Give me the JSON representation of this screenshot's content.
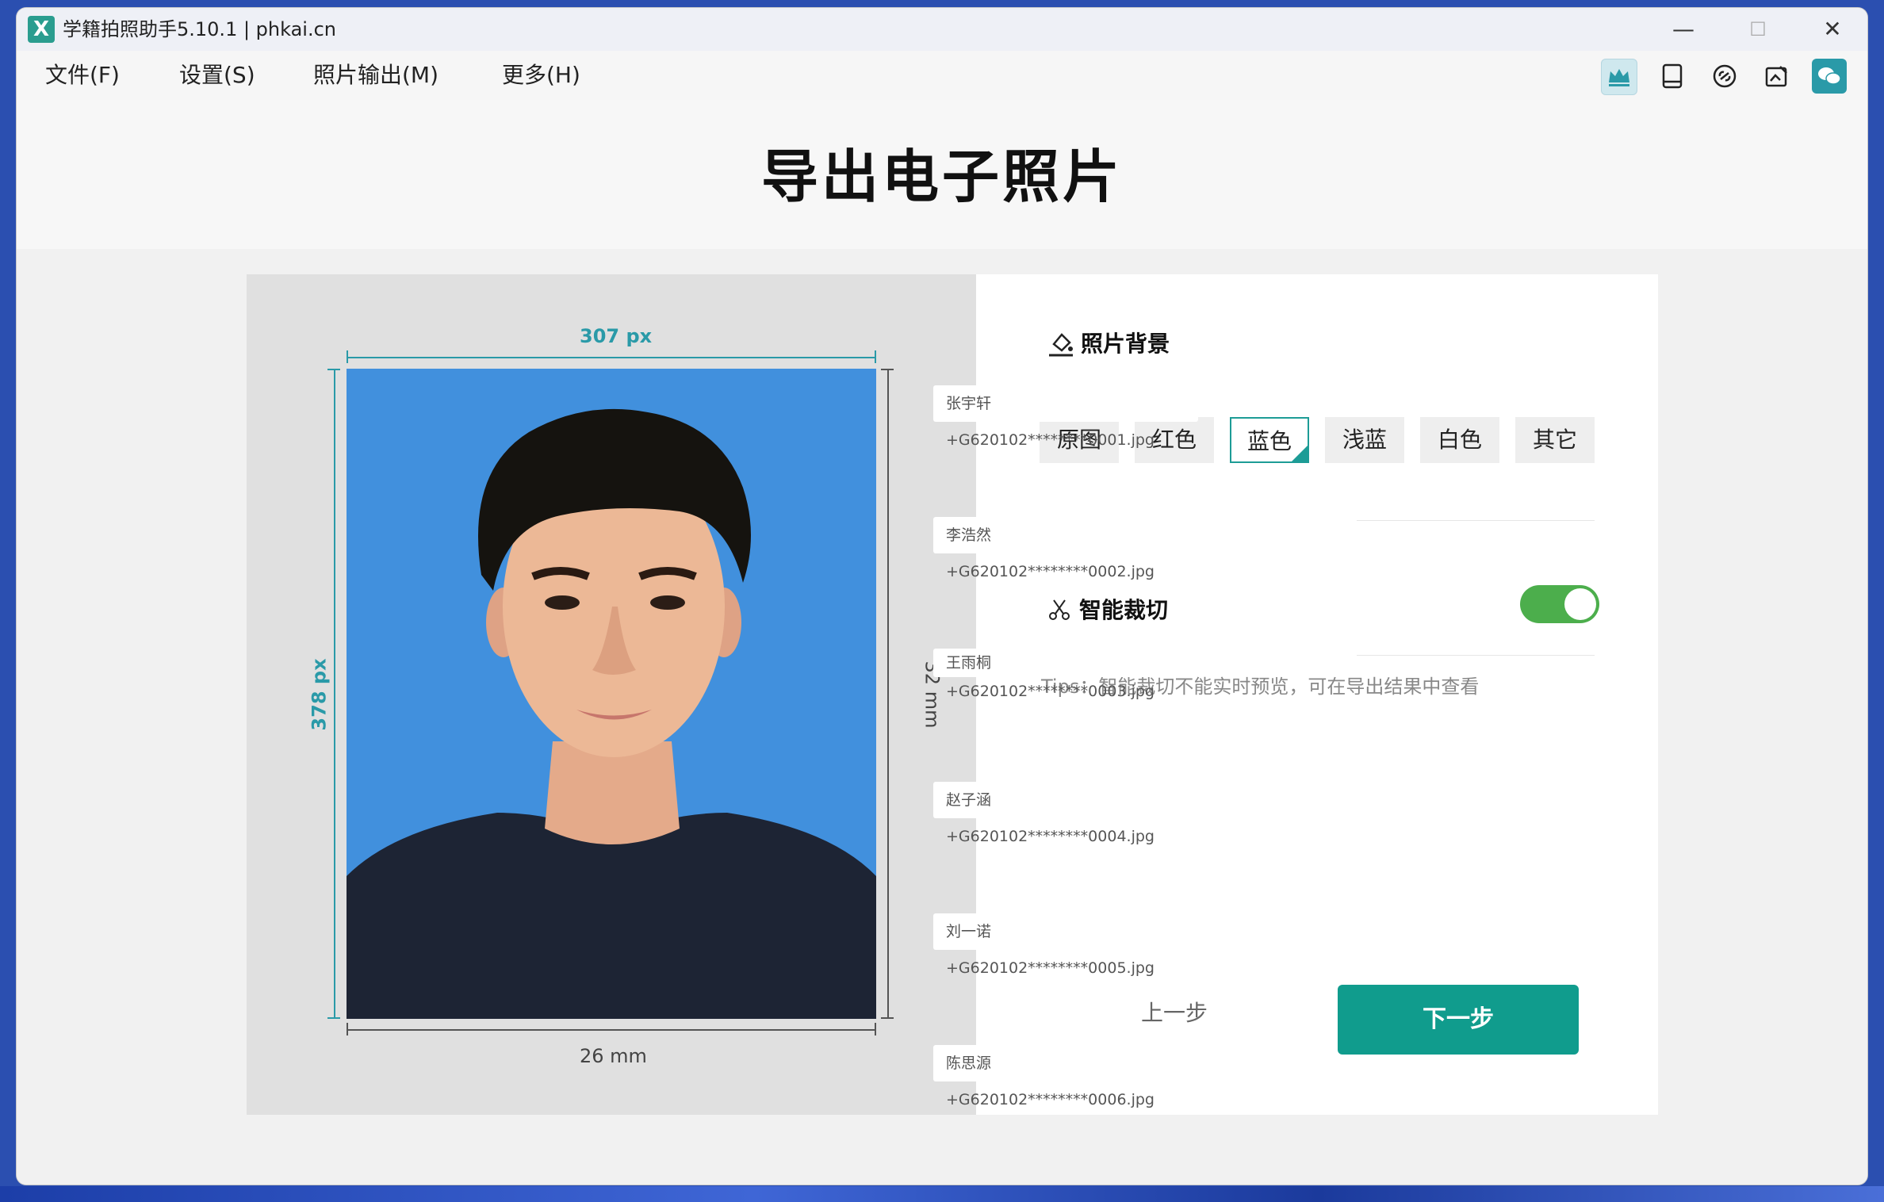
{
  "window": {
    "title": "学籍拍照助手5.10.1 | phkai.cn",
    "logo_letter": "X",
    "minimize": "—",
    "maximize": "☐",
    "close": "✕"
  },
  "menu": {
    "items": [
      "文件(F)",
      "设置(S)",
      "照片输出(M)",
      "更多(H)"
    ]
  },
  "toolbar": {
    "icons": [
      "crown-icon",
      "tablet-icon",
      "link-icon",
      "image-edit-icon",
      "wechat-icon"
    ],
    "accent": "#2a9d8f"
  },
  "page": {
    "title": "导出电子照片"
  },
  "preview": {
    "width_px": "307 px",
    "height_px": "378 px",
    "width_mm": "26 mm",
    "height_mm": "32 mm",
    "photo_bg_color": "#4190dd"
  },
  "background_section": {
    "title": "照片背景",
    "options": [
      "原图",
      "红色",
      "蓝色",
      "浅蓝",
      "白色",
      "其它"
    ],
    "selected": "蓝色"
  },
  "crop_section": {
    "title": "智能裁切",
    "enabled": true,
    "tips": "Tips：智能裁切不能实时预览，可在导出结果中查看"
  },
  "actions": {
    "prev": "上一步",
    "next": "下一步"
  },
  "files": [
    "张宇轩+G620102********0001.jpg",
    "李浩然+G620102********0002.jpg",
    "王雨桐+G620102********0003.jpg",
    "赵子涵+G620102********0004.jpg",
    "刘一诺+G620102********0005.jpg",
    "陈思源+G620102********0006.jpg"
  ]
}
